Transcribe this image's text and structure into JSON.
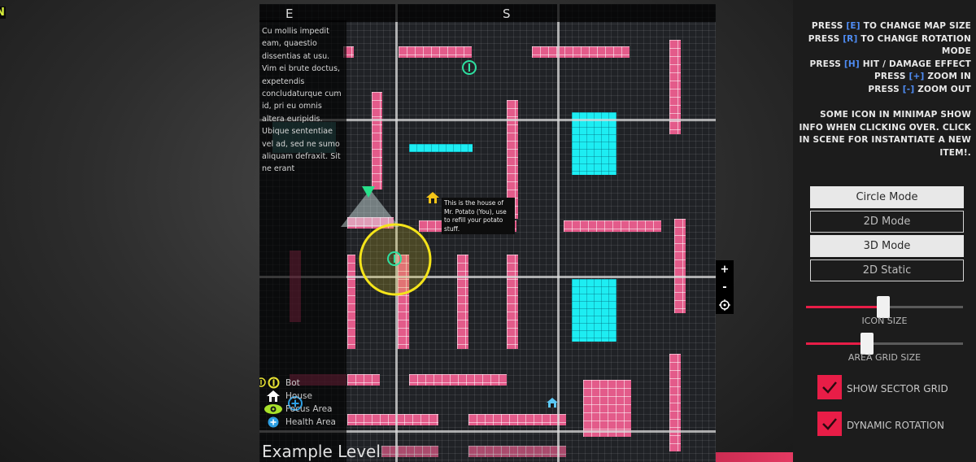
{
  "map": {
    "compass_n": "N",
    "compass_e": "E",
    "compass_s": "S",
    "info_text": "Cu mollis impedit eam, quaestio dissentias at usu. Vim ei brute doctus, expetendis concludaturque cum id, pri eu omnis altera euripidis. Ubique sententiae vel ad, sed ne sumo aliquam defraxit. Sit ne erant",
    "tooltip": "This is the house of Mr. Potato (You), use to refill your potato stuff.",
    "level_name": "Example Level",
    "legend": [
      {
        "icon": "bot-icon",
        "label": "Bot",
        "color": "#e8e233"
      },
      {
        "icon": "house-icon",
        "label": "House",
        "color": "#ffffff"
      },
      {
        "icon": "eye-icon",
        "label": "Focus Area",
        "color": "#a8e22a"
      },
      {
        "icon": "health-plus-icon",
        "label": "Health Area",
        "color": "#2d9fe3"
      }
    ]
  },
  "zoom": {
    "plus": "+",
    "minus": "-",
    "center_icon": "crosshair-icon"
  },
  "help": {
    "keys": [
      {
        "prefix": "PRESS ",
        "key": "[E]",
        "suffix": " TO CHANGE MAP SIZE"
      },
      {
        "prefix": "PRESS ",
        "key": "[R]",
        "suffix": " TO CHANGE ROTATION MODE"
      },
      {
        "prefix": "PRESS ",
        "key": "[H]",
        "suffix": " HIT / DAMAGE EFFECT"
      },
      {
        "prefix": "PRESS ",
        "key": "[+]",
        "suffix": " ZOOM IN"
      },
      {
        "prefix": "PRESS ",
        "key": "[-]",
        "suffix": " ZOOM OUT"
      }
    ],
    "info": "SOME ICON IN MINIMAP SHOW INFO WHEN CLICKING OVER. CLICK IN SCENE FOR INSTANTIATE A NEW ITEM!."
  },
  "modes": [
    {
      "label": "Circle Mode",
      "style": "light"
    },
    {
      "label": "2D Mode",
      "style": "dark"
    },
    {
      "label": "3D Mode",
      "style": "light"
    },
    {
      "label": "2D Static",
      "style": "dark"
    }
  ],
  "sliders": [
    {
      "label": "ICON SIZE",
      "value": 0.49
    },
    {
      "label": "AREA GRID SIZE",
      "value": 0.39
    }
  ],
  "checkboxes": [
    {
      "label": "SHOW SECTOR GRID",
      "checked": true
    },
    {
      "label": "DYNAMIC ROTATION",
      "checked": true
    }
  ],
  "colors": {
    "accent": "#e81d47",
    "key_blue": "#4f8df5",
    "wall_pink": "#e35b8a",
    "water_cyan": "#1dedf2"
  }
}
